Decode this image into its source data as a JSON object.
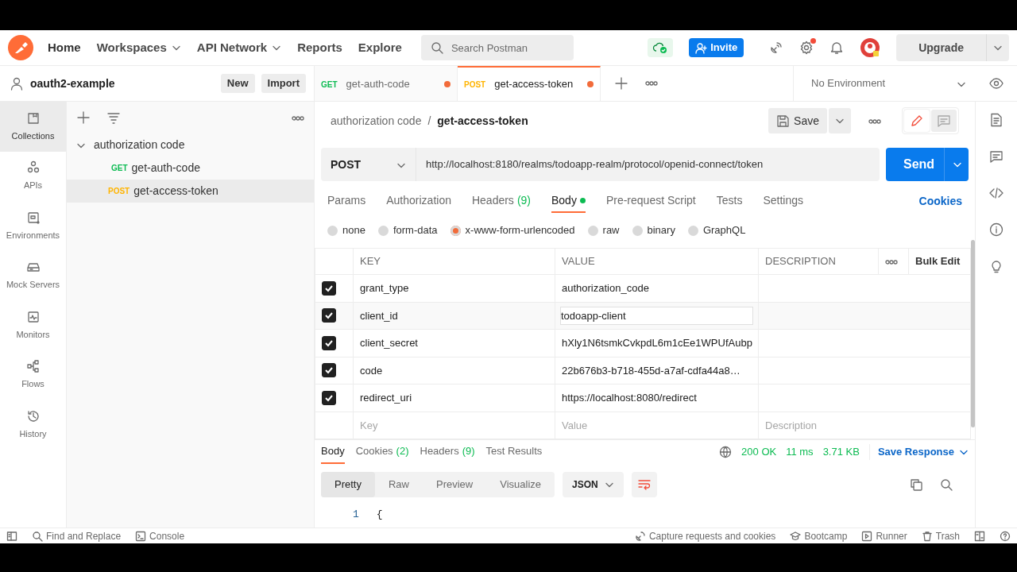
{
  "topbar": {
    "nav": [
      {
        "label": "Home",
        "dropdown": false
      },
      {
        "label": "Workspaces",
        "dropdown": true
      },
      {
        "label": "API Network",
        "dropdown": true
      },
      {
        "label": "Reports",
        "dropdown": false
      },
      {
        "label": "Explore",
        "dropdown": false
      }
    ],
    "search": {
      "placeholder": "Search Postman"
    },
    "invite": "Invite",
    "upgrade": "Upgrade"
  },
  "workspace": {
    "name": "oauth2-example",
    "buttons": [
      "New",
      "Import"
    ]
  },
  "sidebar": {
    "items": [
      {
        "label": "Collections",
        "selected": true
      },
      {
        "label": "APIs",
        "selected": false
      },
      {
        "label": "Environments",
        "selected": false
      },
      {
        "label": "Mock Servers",
        "selected": false
      },
      {
        "label": "Monitors",
        "selected": false
      },
      {
        "label": "Flows",
        "selected": false
      },
      {
        "label": "History",
        "selected": false
      }
    ]
  },
  "collections": [
    {
      "name": "authorization code",
      "expanded": true,
      "children": [
        {
          "method": "GET",
          "color": "#0cbb52",
          "name": "get-auth-code",
          "selected": false
        },
        {
          "method": "POST",
          "color": "#ffb400",
          "name": "get-access-token",
          "selected": true
        }
      ]
    }
  ],
  "tabs": [
    {
      "method": "GET",
      "color": "#0cbb52",
      "label": "get-auth-code",
      "selected": false,
      "unsaved": true
    },
    {
      "method": "POST",
      "color": "#ffb400",
      "label": "get-access-token",
      "selected": true,
      "unsaved": true
    }
  ],
  "environment": "No Environment",
  "request": {
    "breadcrumb": [
      "authorization code",
      "get-access-token"
    ],
    "breadcrumb_separator": "/",
    "save": "Save",
    "method": "POST",
    "url": "http://localhost:8180/realms/todoapp-realm/protocol/openid-connect/token",
    "send": "Send",
    "tabs": [
      {
        "label": "Params",
        "selected": false
      },
      {
        "label": "Authorization",
        "selected": false
      },
      {
        "label": "Headers",
        "count": "(9)",
        "selected": false
      },
      {
        "label": "Body",
        "selected": true,
        "indicator": true
      },
      {
        "label": "Pre-request Script",
        "selected": false
      },
      {
        "label": "Tests",
        "selected": false
      },
      {
        "label": "Settings",
        "selected": false
      }
    ],
    "cookies": "Cookies",
    "body_types": [
      {
        "label": "none",
        "selected": false
      },
      {
        "label": "form-data",
        "selected": false
      },
      {
        "label": "x-www-form-urlencoded",
        "selected": true
      },
      {
        "label": "raw",
        "selected": false
      },
      {
        "label": "binary",
        "selected": false
      },
      {
        "label": "GraphQL",
        "selected": false
      }
    ],
    "params": {
      "columns": [
        "KEY",
        "VALUE",
        "DESCRIPTION"
      ],
      "bulk_edit": "Bulk Edit",
      "rows": [
        {
          "checked": true,
          "key": "grant_type",
          "value": "authorization_code",
          "editing": false
        },
        {
          "checked": true,
          "key": "client_id",
          "value": "todoapp-client",
          "editing": true
        },
        {
          "checked": true,
          "key": "client_secret",
          "value": "hXly1N6tsmkCvkpdL6m1cEe1WPUfAubp",
          "editing": false
        },
        {
          "checked": true,
          "key": "code",
          "value": "22b676b3-b718-455d-a7af-cdfa44a8…",
          "editing": false
        },
        {
          "checked": true,
          "key": "redirect_uri",
          "value": "https://localhost:8080/redirect",
          "editing": false
        }
      ],
      "new_row": [
        {
          "placeholder": "Key"
        },
        {
          "placeholder": "Value"
        },
        {
          "placeholder": "Description"
        }
      ]
    }
  },
  "response": {
    "tabs": [
      {
        "label": "Body",
        "selected": true
      },
      {
        "label": "Cookies",
        "count": "(2)",
        "selected": false
      },
      {
        "label": "Headers",
        "count": "(9)",
        "selected": false
      },
      {
        "label": "Test Results",
        "selected": false
      }
    ],
    "status": "200 OK",
    "time": "11 ms",
    "size": "3.71 KB",
    "save": "Save Response",
    "views": [
      {
        "label": "Pretty",
        "selected": true
      },
      {
        "label": "Raw",
        "selected": false
      },
      {
        "label": "Preview",
        "selected": false
      },
      {
        "label": "Visualize",
        "selected": false
      }
    ],
    "format": "JSON",
    "lines": [
      {
        "number": "1",
        "text": "{"
      }
    ]
  },
  "status_bar": {
    "left": [
      "Find and Replace",
      "Console"
    ],
    "right": [
      "Capture requests and cookies",
      "Bootcamp",
      "Runner",
      "Trash"
    ]
  }
}
